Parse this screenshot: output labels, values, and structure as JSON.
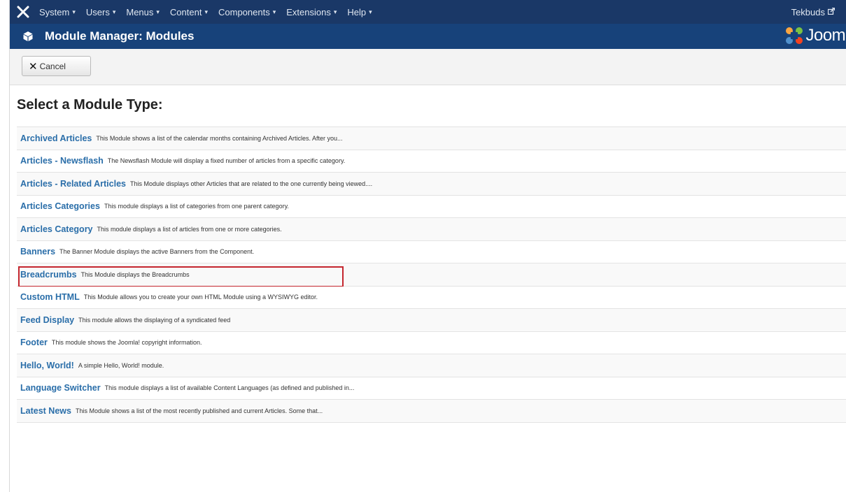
{
  "topnav": {
    "menu": [
      {
        "label": "System"
      },
      {
        "label": "Users"
      },
      {
        "label": "Menus"
      },
      {
        "label": "Content"
      },
      {
        "label": "Components"
      },
      {
        "label": "Extensions"
      },
      {
        "label": "Help"
      }
    ],
    "user_label": "Tekbuds"
  },
  "titlebar": {
    "title": "Module Manager: Modules",
    "brand_text": "Jooml"
  },
  "toolbar": {
    "cancel_label": "Cancel"
  },
  "main": {
    "heading": "Select a Module Type:",
    "modules": [
      {
        "name": "Archived Articles",
        "description": "This Module shows a list of the calendar months containing Archived Articles. After you..."
      },
      {
        "name": "Articles - Newsflash",
        "description": "The Newsflash Module will display a fixed number of articles from a specific category."
      },
      {
        "name": "Articles - Related Articles",
        "description": "This Module displays other Articles that are related to the one currently being viewed...."
      },
      {
        "name": "Articles Categories",
        "description": "This module displays a list of categories from one parent category."
      },
      {
        "name": "Articles Category",
        "description": "This module displays a list of articles from one or more categories."
      },
      {
        "name": "Banners",
        "description": "The Banner Module displays the active Banners from the Component."
      },
      {
        "name": "Breadcrumbs",
        "description": "This Module displays the Breadcrumbs"
      },
      {
        "name": "Custom HTML",
        "description": "This Module allows you to create your own HTML Module using a WYSIWYG editor."
      },
      {
        "name": "Feed Display",
        "description": "This module allows the displaying of a syndicated feed"
      },
      {
        "name": "Footer",
        "description": "This module shows the Joomla! copyright information."
      },
      {
        "name": "Hello, World!",
        "description": "A simple Hello, World! module."
      },
      {
        "name": "Language Switcher",
        "description": "This module displays a list of available Content Languages (as defined and published in..."
      },
      {
        "name": "Latest News",
        "description": "This Module shows a list of the most recently published and current Articles. Some that..."
      }
    ],
    "highlighted_module": "Breadcrumbs"
  },
  "colors": {
    "topnav_bg": "#1a3867",
    "titlebar_bg": "#17427a",
    "link": "#2a6ea9",
    "highlight_border": "#c4262e"
  },
  "icons": {
    "logo": "joomla-logo-icon",
    "module": "cube-icon",
    "external": "external-link-icon",
    "cancel": "close-icon",
    "caret": "caret-down-icon"
  }
}
